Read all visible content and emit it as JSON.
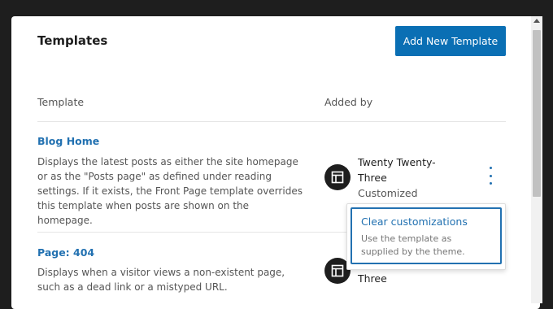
{
  "modal": {
    "title": "Templates",
    "add_button_label": "Add New Template"
  },
  "table": {
    "headers": {
      "template": "Template",
      "added_by": "Added by"
    },
    "rows": [
      {
        "title": "Blog Home",
        "description": "Displays the latest posts as either the site homepage or as the \"Posts page\" as defined under reading settings. If it exists, the Front Page template overrides this template when posts are shown on the homepage.",
        "author_icon": "layout-icon",
        "author": "Twenty Twenty-Three",
        "status": "Customized"
      },
      {
        "title": "Page: 404",
        "description": "Displays when a visitor views a non-existent page, such as a dead link or a mistyped URL.",
        "author_icon": "layout-icon",
        "author_visible": "Three"
      }
    ]
  },
  "actions_menu": {
    "icon": "more-vertical-icon",
    "items": [
      {
        "label": "Clear customizations",
        "help": "Use the template as supplied by the theme."
      }
    ]
  },
  "colors": {
    "accent": "#2271b1",
    "button": "#0a6fb4",
    "backdrop": "#1e1e1e"
  }
}
